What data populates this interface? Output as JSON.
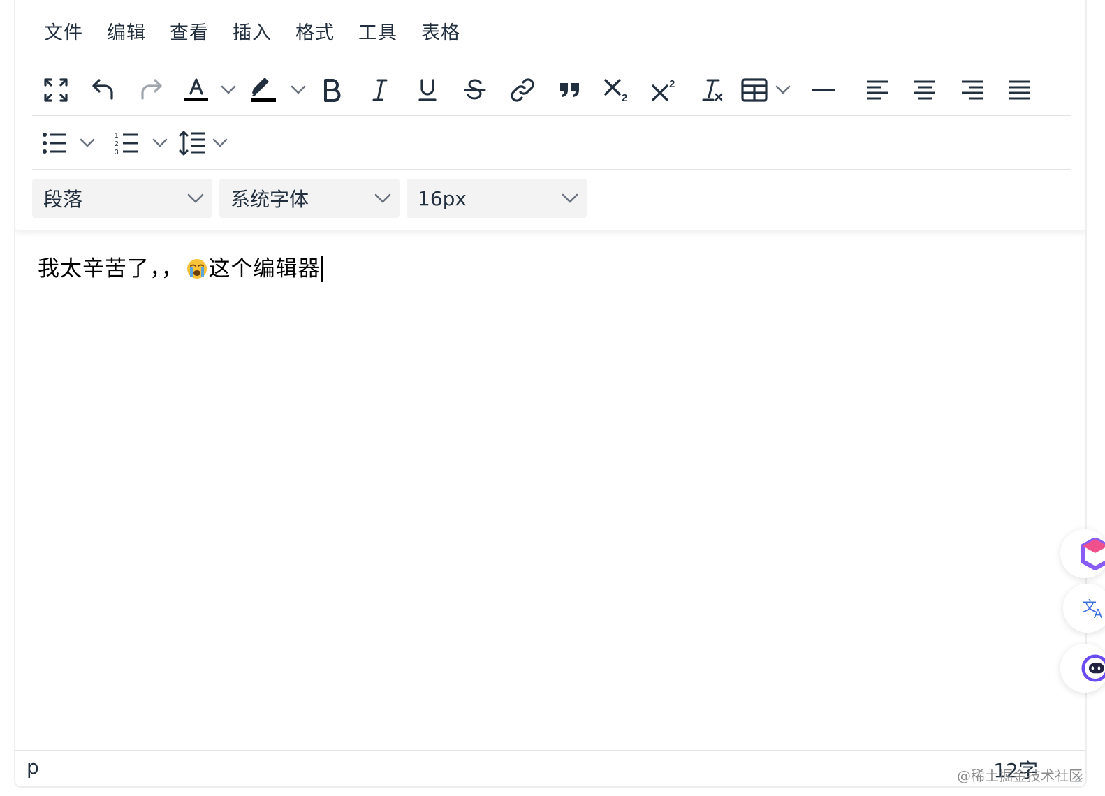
{
  "menubar": {
    "items": [
      "文件",
      "编辑",
      "查看",
      "插入",
      "格式",
      "工具",
      "表格"
    ]
  },
  "toolbar": {
    "row1": [
      "fullscreen",
      "undo",
      "redo",
      "text-color",
      "highlight-color",
      "bold",
      "italic",
      "underline",
      "strikethrough",
      "link",
      "blockquote",
      "subscript",
      "superscript",
      "remove-format",
      "table",
      "horizontal-rule",
      "align-left",
      "align-center",
      "align-right",
      "align-justify"
    ],
    "row2": [
      "bullet-list",
      "numbered-list",
      "line-height"
    ]
  },
  "selects": {
    "block_format": "段落",
    "font_family": "系统字体",
    "font_size": "16px"
  },
  "content": {
    "text_before": "我太辛苦了，，",
    "emoji": "loudly-crying-face",
    "text_after": "这个编辑器"
  },
  "statusbar": {
    "path": "p",
    "word_count": "12字",
    "watermark": "@稀土掘金技术社区"
  },
  "colors": {
    "icon": "#222f3e",
    "select_bg": "#f3f3f3",
    "divider": "#e3e3e3",
    "accent": "#207ab7"
  }
}
